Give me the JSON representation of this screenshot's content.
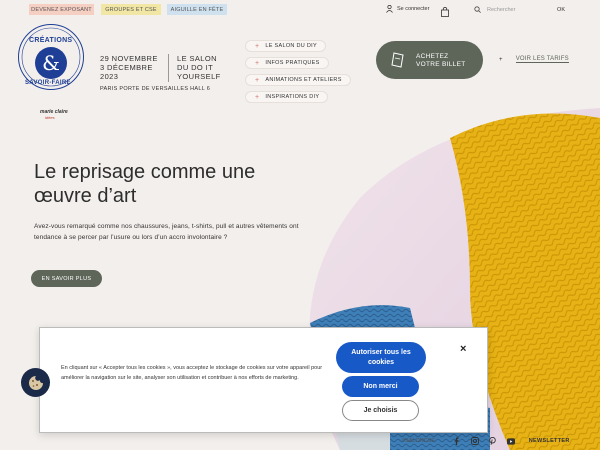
{
  "topbar": {
    "links": [
      "DEVENEZ EXPOSANT",
      "GROUPES ET CSE",
      "AIGUILLE EN FÊTE"
    ],
    "login": "Se connecter",
    "search_placeholder": "Rechercher",
    "search_ok": "OK"
  },
  "logo": {
    "top": "CRÉATIONS",
    "amp": "&",
    "bottom": "SAVOIR-FAIRE",
    "brand": "marie claire",
    "brand_sub": "idées"
  },
  "event": {
    "date_line1": "29 NOVEMBRE",
    "date_line2": "3 DÉCEMBRE",
    "date_line3": "2023",
    "venue": "PARIS PORTE DE VERSAILLES HALL 6",
    "tagline_line1": "LE SALON",
    "tagline_line2": "DU DO IT",
    "tagline_line3": "YOURSELF"
  },
  "nav": {
    "items": [
      "LE SALON DU DIY",
      "INFOS PRATIQUES",
      "ANIMATIONS ET ATELIERS",
      "INSPIRATIONS DIY"
    ]
  },
  "ticket": {
    "line1": "ACHETEZ",
    "line2": "VOTRE BILLET"
  },
  "tarifs": {
    "plus": "+",
    "link": "VOIR LES TARIFS"
  },
  "hero": {
    "title_line1": "Le reprisage comme une",
    "title_line2": "œuvre d’art",
    "text": "Avez-vous remarqué comme nos chaussures, jeans, t-shirts, pull et autres vêtements ont tendance à se percer par l’usure ou lors d’un accro involontaire ?",
    "button": "EN SAVOIR PLUS"
  },
  "social": {
    "hashtag": "#SALONCSF",
    "newsletter": "NEWSLETTER"
  },
  "cookie": {
    "text": "En cliquant sur « Accepter tous les cookies », vous acceptez le stockage de cookies sur votre appareil pour améliorer la navigation sur le site, analyser son utilisation et contribuer à nos efforts de marketing.",
    "accept_line1": "Autoriser tous les",
    "accept_line2": "cookies",
    "refuse": "Non merci",
    "choose": "Je choisis",
    "close": "×"
  },
  "colors": {
    "accent": "#5e6659",
    "cookie_button": "#1859c8",
    "logo_blue": "#1e3f95"
  }
}
